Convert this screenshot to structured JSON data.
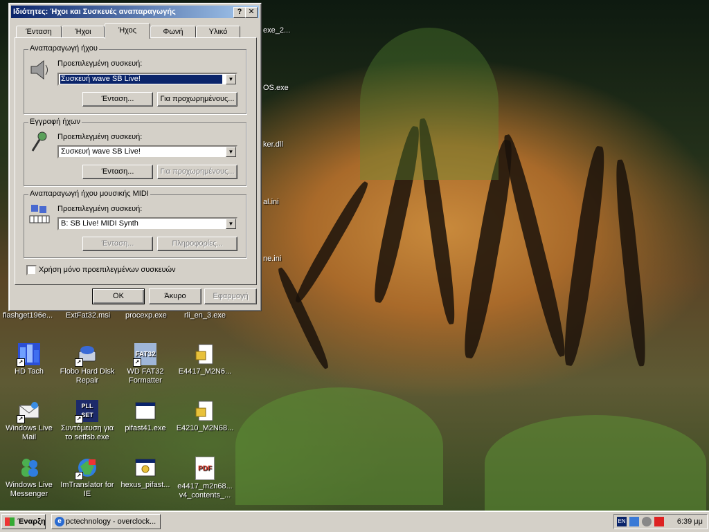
{
  "desktop": {
    "partial_labels": [
      {
        "text": "exe_2..."
      },
      {
        "text": "OS.exe"
      },
      {
        "text": "ker.dll"
      },
      {
        "text": "al.ini"
      },
      {
        "text": "ne.ini"
      }
    ],
    "row1_labels": [
      "flashget196e...",
      "ExtFat32.msi",
      "procexp.exe",
      "rli_en_3.exe"
    ],
    "icons": [
      {
        "label": "HD Tach",
        "icon": "hd-tach-icon"
      },
      {
        "label": "Flobo Hard Disk Repair",
        "icon": "hard-disk-repair-icon"
      },
      {
        "label": "WD FAT32 Formatter",
        "icon": "fat32-formatter-icon",
        "glyph": "FAT32"
      },
      {
        "label": "E4417_M2N6...",
        "icon": "document-file-icon"
      },
      {
        "label": "Windows Live Mail",
        "icon": "windows-live-mail-icon"
      },
      {
        "label": "Συντόμευση για το setfsb.exe",
        "icon": "setfsb-icon",
        "glyph": "PLL SET"
      },
      {
        "label": "pifast41.exe",
        "icon": "program-window-icon"
      },
      {
        "label": "E4210_M2N68...",
        "icon": "document-file-icon"
      },
      {
        "label": "Windows Live Messenger",
        "icon": "windows-live-messenger-icon"
      },
      {
        "label": "ImTranslator for IE",
        "icon": "imtranslator-icon"
      },
      {
        "label": "hexus_pifast...",
        "icon": "program-gear-icon"
      },
      {
        "label": "e4417_m2n68... v4_contents_...",
        "icon": "pdf-file-icon",
        "glyph": "PDF"
      }
    ]
  },
  "dialog": {
    "title": "Ιδιότητες: Ήχοι και Συσκευές αναπαραγωγής",
    "help_button": "?",
    "close_button": "✕",
    "tabs": [
      {
        "label": "Ένταση",
        "active": false
      },
      {
        "label": "Ήχοι",
        "active": false
      },
      {
        "label": "Ήχος",
        "active": true
      },
      {
        "label": "Φωνή",
        "active": false
      },
      {
        "label": "Υλικό",
        "active": false
      }
    ],
    "playback": {
      "group_title": "Αναπαραγωγή ήχου",
      "label": "Προεπιλεγμένη συσκευή:",
      "device": "Συσκευή wave SB Live!",
      "volume_button": "Ένταση...",
      "advanced_button": "Για προχωρημένους..."
    },
    "recording": {
      "group_title": "Εγγραφή ήχων",
      "label": "Προεπιλεγμένη συσκευή:",
      "device": "Συσκευή wave SB Live!",
      "volume_button": "Ένταση...",
      "advanced_button": "Για προχωρημένους..."
    },
    "midi": {
      "group_title": "Αναπαραγωγή ήχου μουσικής MIDI",
      "label": "Προεπιλεγμένη συσκευή:",
      "device": "B: SB Live! MIDI Synth",
      "volume_button": "Ένταση...",
      "info_button": "Πληροφορίες..."
    },
    "checkbox_label": "Χρήση μόνο προεπιλεγμένων συσκευών",
    "ok_button": "OK",
    "cancel_button": "Άκυρο",
    "apply_button": "Εφαρμογή"
  },
  "taskbar": {
    "start_label": "Έναρξη",
    "task_label": "pctechnology - overclock...",
    "language": "EN",
    "clock": "6:39 μμ"
  },
  "colors": {
    "titlebar_start": "#0a246a",
    "titlebar_end": "#a6caf0",
    "face": "#d4d0c8"
  }
}
